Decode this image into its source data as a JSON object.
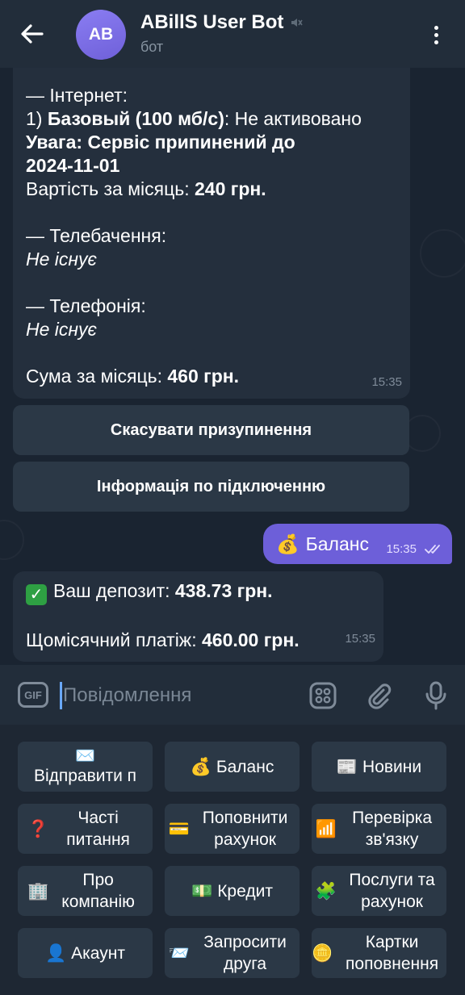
{
  "header": {
    "avatar_initials": "AB",
    "title": "ABillS User Bot",
    "muted_icon": "muted-speaker-icon",
    "subtitle": "бот"
  },
  "messages": {
    "service_info": {
      "lines": [
        {
          "parts": [
            {
              "text": "— Інтернет:",
              "style": "normal"
            }
          ]
        },
        {
          "parts": [
            {
              "text": "1) ",
              "style": "normal"
            },
            {
              "text": "Базовый (100 мб/с)",
              "style": "bold"
            },
            {
              "text": ": Не активовано",
              "style": "normal"
            }
          ]
        },
        {
          "parts": [
            {
              "text": "Увага: Сервіс припинений до",
              "style": "bold"
            }
          ]
        },
        {
          "parts": [
            {
              "text": "2024-11-01",
              "style": "bold"
            }
          ]
        },
        {
          "parts": [
            {
              "text": "Вартість за місяць: ",
              "style": "normal"
            },
            {
              "text": "240 грн.",
              "style": "bold"
            }
          ]
        },
        {
          "parts": [
            {
              "text": "",
              "style": "normal"
            }
          ]
        },
        {
          "parts": [
            {
              "text": "— Телебачення:",
              "style": "normal"
            }
          ]
        },
        {
          "parts": [
            {
              "text": "Не існує",
              "style": "italic"
            }
          ]
        },
        {
          "parts": [
            {
              "text": "",
              "style": "normal"
            }
          ]
        },
        {
          "parts": [
            {
              "text": "— Телефонія:",
              "style": "normal"
            }
          ]
        },
        {
          "parts": [
            {
              "text": "Не існує",
              "style": "italic"
            }
          ]
        },
        {
          "parts": [
            {
              "text": "",
              "style": "normal"
            }
          ]
        },
        {
          "parts": [
            {
              "text": "Сума за місяць: ",
              "style": "normal"
            },
            {
              "text": "460 грн.",
              "style": "bold"
            }
          ]
        }
      ],
      "time": "15:35"
    },
    "inline_buttons": [
      "Скасувати призупинення",
      "Інформація по підключенню"
    ],
    "outgoing": {
      "emoji": "💰",
      "text": "Баланс",
      "time": "15:35",
      "status": "read"
    },
    "balance": {
      "deposit_label": "Ваш депозит: ",
      "deposit_value": "438.73 грн.",
      "payment_label": "Щомісячний платіж: ",
      "payment_value": "460.00 грн.",
      "time": "15:35"
    }
  },
  "input": {
    "gif_label": "GIF",
    "placeholder": "Повідомлення",
    "value": ""
  },
  "keyboard": {
    "buttons": [
      {
        "icon": "✉️",
        "label": "Відправити п"
      },
      {
        "icon": "💰",
        "label": "Баланс"
      },
      {
        "icon": "📰",
        "label": "Новини"
      },
      {
        "icon": "❓",
        "label": "Часті питання"
      },
      {
        "icon": "💳",
        "label": "Поповнити рахунок"
      },
      {
        "icon": "📶",
        "label": "Перевірка зв'язку"
      },
      {
        "icon": "🏢",
        "label": "Про компанію"
      },
      {
        "icon": "💵",
        "label": "Кредит"
      },
      {
        "icon": "🧩",
        "label": "Послуги та рахунок"
      },
      {
        "icon": "👤",
        "label": "Акаунт"
      },
      {
        "icon": "📨",
        "label": "Запросити друга"
      },
      {
        "icon": "🪙",
        "label": "Картки поповнення"
      }
    ]
  }
}
